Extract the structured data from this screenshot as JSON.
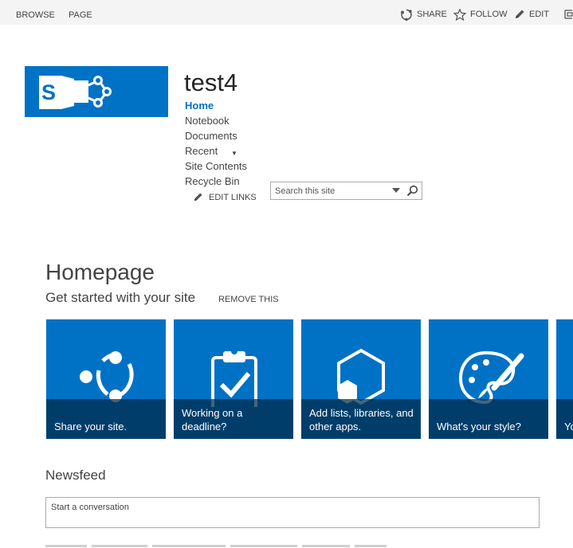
{
  "ribbon": {
    "tabs": [
      "BROWSE",
      "PAGE"
    ],
    "share_label": "SHARE",
    "follow_label": "FOLLOW",
    "edit_label": "EDIT"
  },
  "site": {
    "title": "test4",
    "brand_color": "#0072c6",
    "logo_letter": "S"
  },
  "quicklaunch": {
    "items": [
      {
        "label": "Home",
        "selected": true
      },
      {
        "label": "Notebook"
      },
      {
        "label": "Documents"
      },
      {
        "label": "Recent"
      },
      {
        "label": "Site Contents"
      },
      {
        "label": "Recycle Bin"
      }
    ],
    "edit_links_label": "EDIT LINKS"
  },
  "search": {
    "placeholder": "Search this site"
  },
  "main": {
    "heading": "Homepage",
    "get_started": "Get started with your site",
    "remove_label": "REMOVE THIS",
    "tiles": [
      {
        "caption": "Share your site.",
        "icon": "share-icon"
      },
      {
        "caption": "Working on a deadline?",
        "icon": "clipboard-check-icon"
      },
      {
        "caption": "Add lists, libraries, and other apps.",
        "icon": "apps-hexagon-icon"
      },
      {
        "caption": "What's your style?",
        "icon": "palette-icon"
      },
      {
        "caption": "Yo",
        "icon": "partial-tile"
      }
    ]
  },
  "newsfeed": {
    "title": "Newsfeed",
    "placeholder": "Start a conversation"
  }
}
